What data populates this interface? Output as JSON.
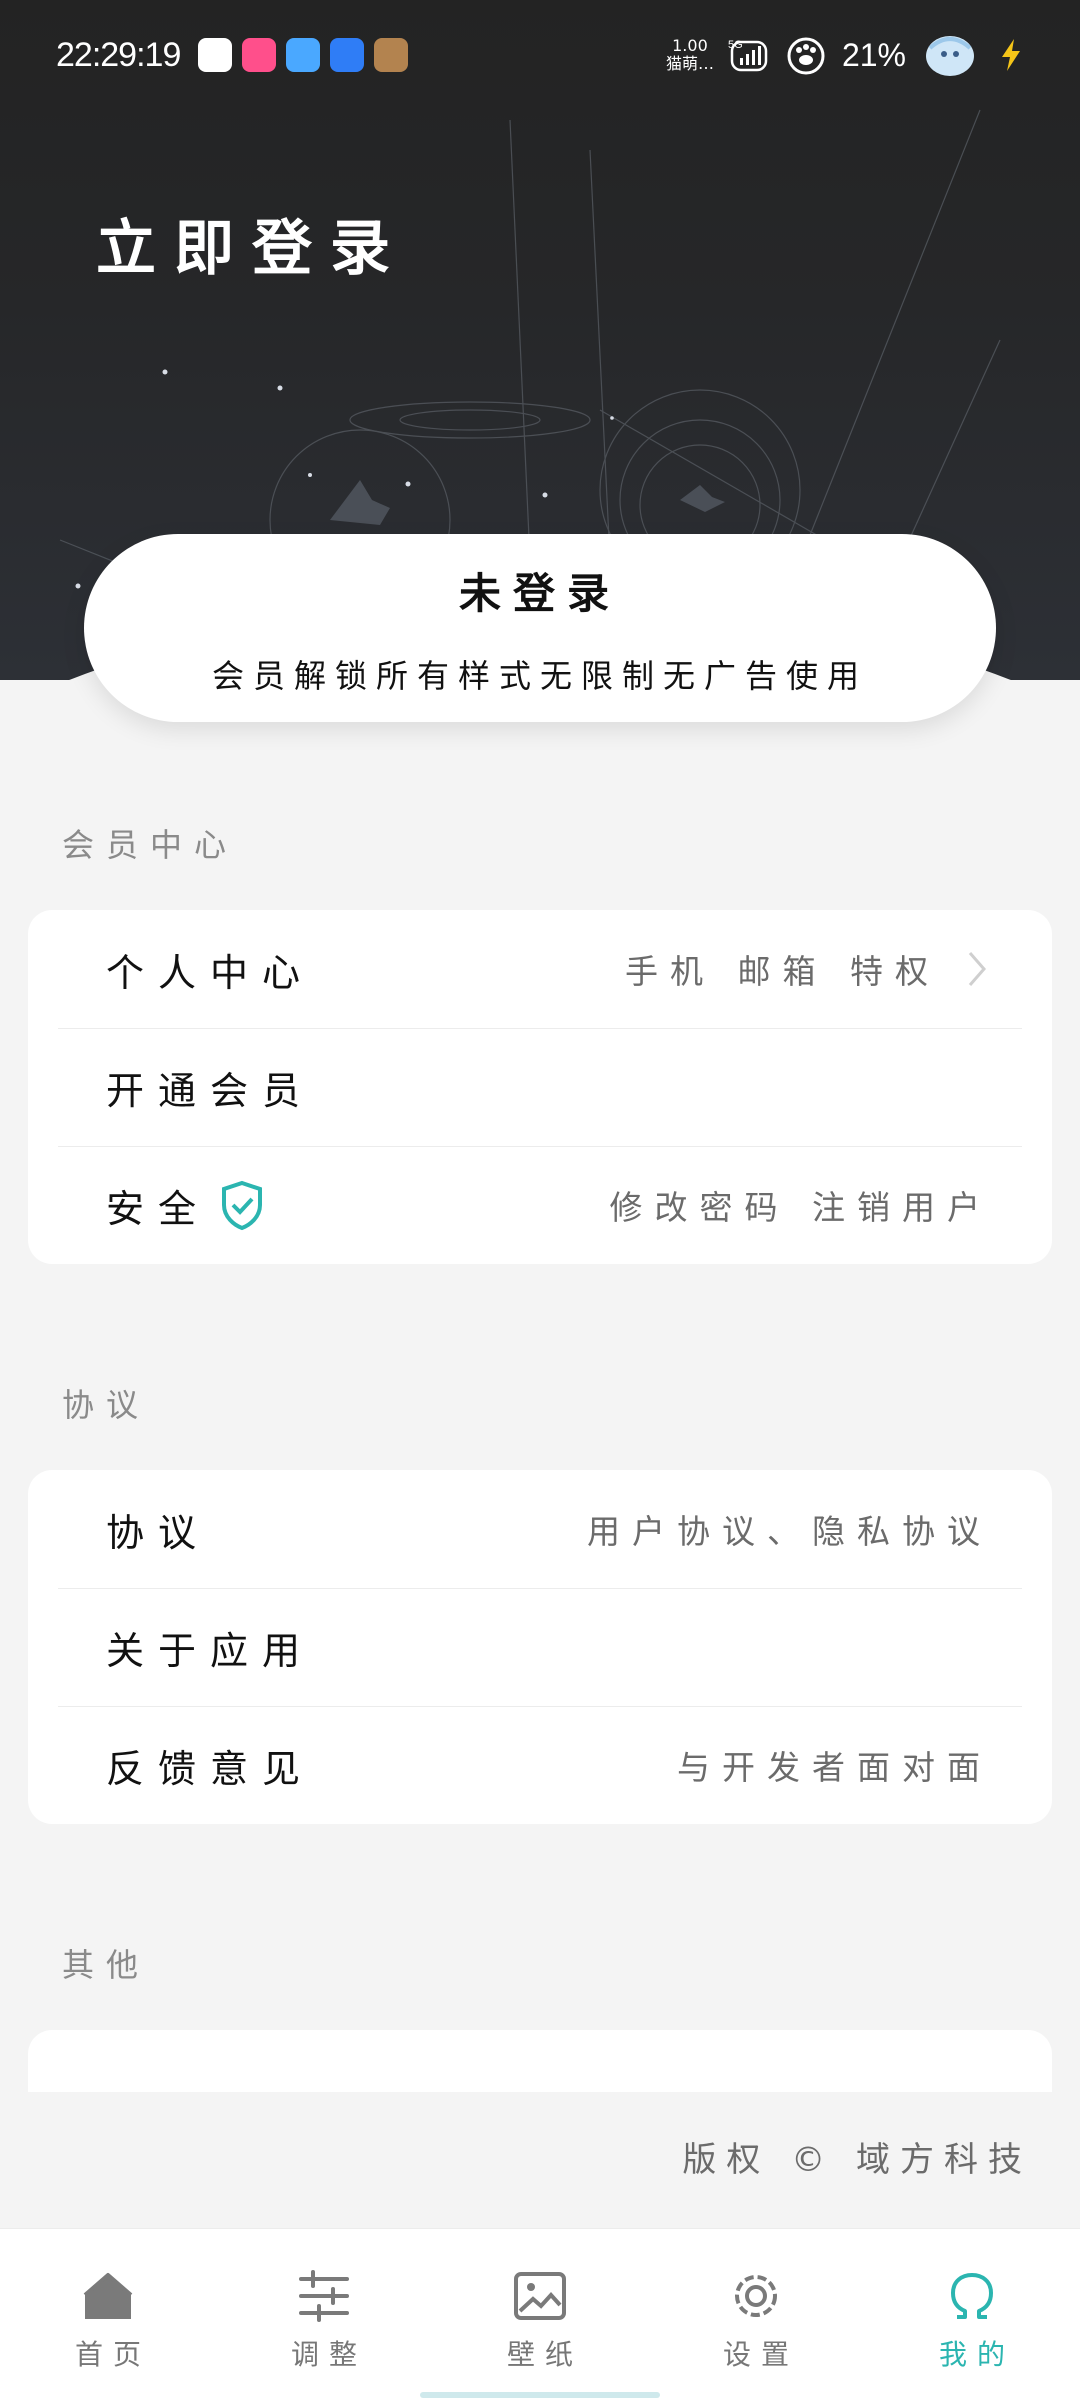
{
  "status_bar": {
    "time": "22:29:19",
    "net_speed": "1.00",
    "net_speed_unit": "猫萌…",
    "network": "5G",
    "battery": "21%"
  },
  "header": {
    "login_title": "立即登录"
  },
  "member_card": {
    "status": "未登录",
    "subtitle": "会员解锁所有样式无限制无广告使用"
  },
  "sections": {
    "member_center": {
      "label": "会员中心",
      "rows": [
        {
          "label": "个人中心",
          "right": "手机 邮箱 特权"
        },
        {
          "label": "开通会员",
          "right": ""
        },
        {
          "label": "安全",
          "right": "修改密码  注销用户"
        }
      ]
    },
    "agreement": {
      "label": "协议",
      "rows": [
        {
          "label": "协议",
          "right": "用户协议、隐私协议"
        },
        {
          "label": "关于应用",
          "right": ""
        },
        {
          "label": "反馈意见",
          "right": "与开发者面对面"
        }
      ]
    },
    "other": {
      "label": "其他"
    }
  },
  "copyright": "版权 © 域方科技",
  "bottom_nav": [
    {
      "label": "首页",
      "icon": "home-icon"
    },
    {
      "label": "调整",
      "icon": "sliders-icon"
    },
    {
      "label": "壁纸",
      "icon": "image-icon"
    },
    {
      "label": "设置",
      "icon": "gear-icon"
    },
    {
      "label": "我的",
      "icon": "omega-icon",
      "active": true
    }
  ],
  "colors": {
    "accent": "#2bb5b0",
    "header_bg": "#262729",
    "page_bg": "#f4f4f4"
  }
}
